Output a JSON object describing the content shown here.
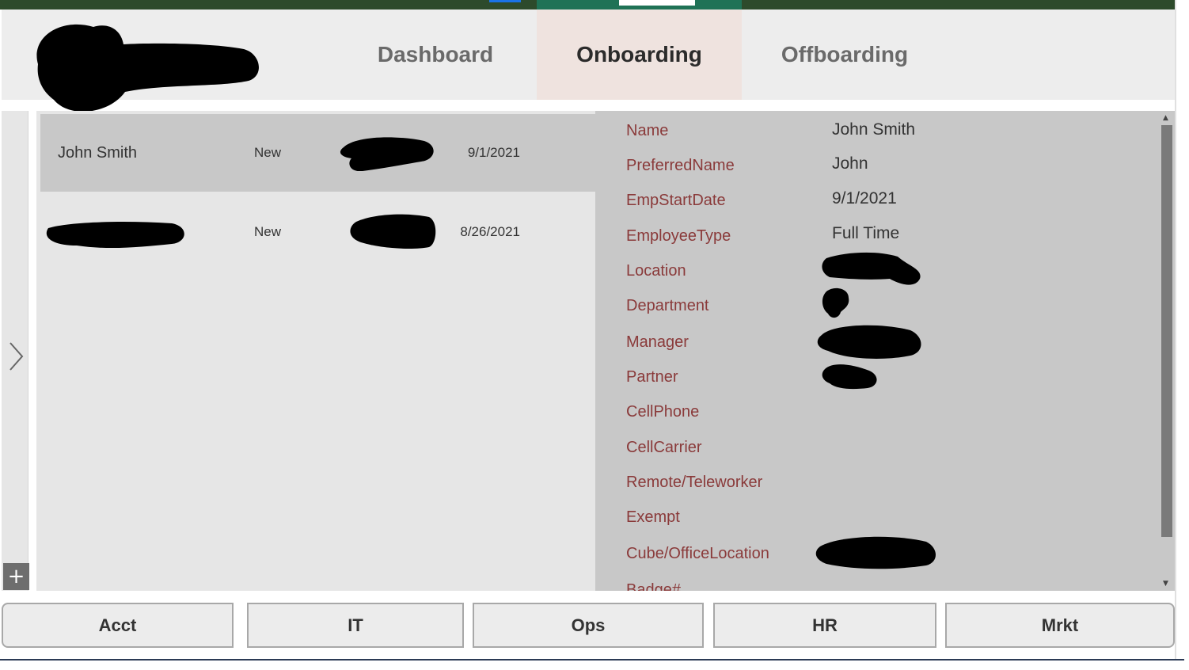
{
  "header": {
    "tabs": [
      {
        "label": "Dashboard"
      },
      {
        "label": "Onboarding"
      },
      {
        "label": "Offboarding"
      }
    ],
    "active_tab": "Onboarding"
  },
  "list": {
    "rows": [
      {
        "name": "John Smith",
        "status": "New",
        "date": "9/1/2021",
        "selected": true
      },
      {
        "name": "",
        "status": "New",
        "date": "8/26/2021",
        "selected": false
      }
    ]
  },
  "detail": {
    "fields": [
      {
        "label": "Name",
        "value": "John Smith"
      },
      {
        "label": "PreferredName",
        "value": "John"
      },
      {
        "label": "EmpStartDate",
        "value": "9/1/2021"
      },
      {
        "label": "EmployeeType",
        "value": "Full Time"
      },
      {
        "label": "Location",
        "value": ""
      },
      {
        "label": "Department",
        "value": ""
      },
      {
        "label": "Manager",
        "value": ""
      },
      {
        "label": "Partner",
        "value": ""
      },
      {
        "label": "CellPhone",
        "value": ""
      },
      {
        "label": "CellCarrier",
        "value": ""
      },
      {
        "label": "Remote/Teleworker",
        "value": ""
      },
      {
        "label": "Exempt",
        "value": ""
      },
      {
        "label": "Cube/OfficeLocation",
        "value": ""
      },
      {
        "label": "Badge#",
        "value": ""
      }
    ]
  },
  "rail": {
    "expand_icon": "chevron-right-icon",
    "add_icon": "plus-icon"
  },
  "buttons": [
    {
      "label": "Acct"
    },
    {
      "label": "IT"
    },
    {
      "label": "Ops"
    },
    {
      "label": "HR"
    },
    {
      "label": "Mrkt"
    }
  ],
  "colors": {
    "top_bar": "#2d4a2b",
    "active_tab_bar": "#1f7256",
    "active_tab_bg": "#efe3df",
    "field_label": "#8a3a3a",
    "selected_row": "#c8c8c8"
  }
}
